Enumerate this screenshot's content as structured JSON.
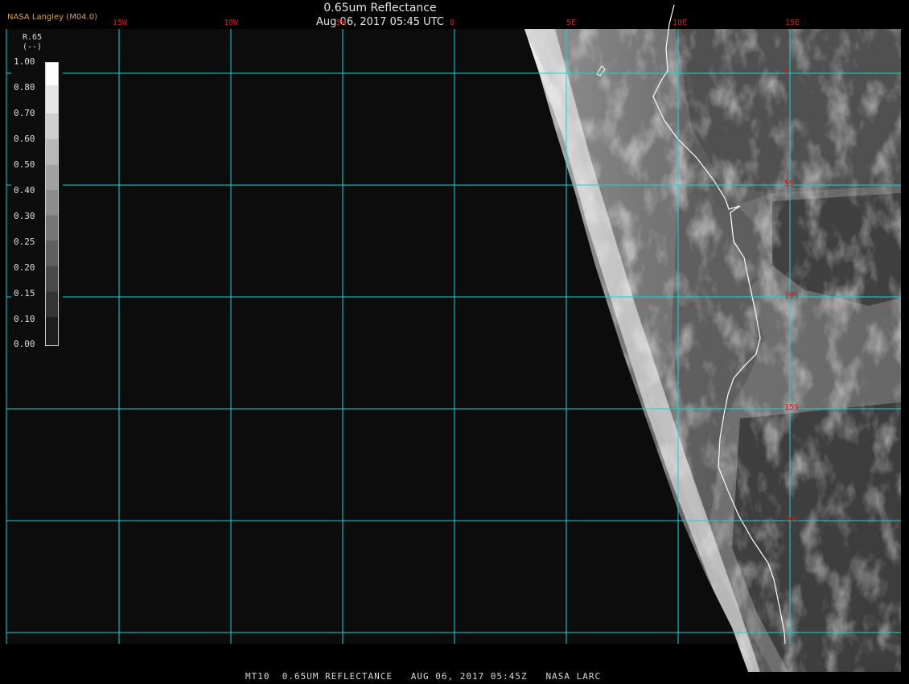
{
  "header": {
    "title": "0.65um Reflectance",
    "subtitle": "Aug 06, 2017 05:45 UTC",
    "provider": "NASA Langley (M04.0)"
  },
  "legend": {
    "title": "R.65",
    "unit": "(--)",
    "ticks": [
      "1.00",
      "0.80",
      "0.70",
      "0.60",
      "0.50",
      "0.40",
      "0.30",
      "0.25",
      "0.20",
      "0.15",
      "0.10",
      "0.00"
    ]
  },
  "grid": {
    "longitudes": [
      "15W",
      "10W",
      "5W",
      "0",
      "5E",
      "10E",
      "15E"
    ],
    "latitudes": [
      "0",
      "5S",
      "10S",
      "15S",
      "20S"
    ],
    "line_color": "#22d0d8",
    "label_color": "#d01818"
  },
  "footer": "MT10  0.65UM REFLECTANCE   AUG 06, 2017 05:45Z   NASA LARC"
}
